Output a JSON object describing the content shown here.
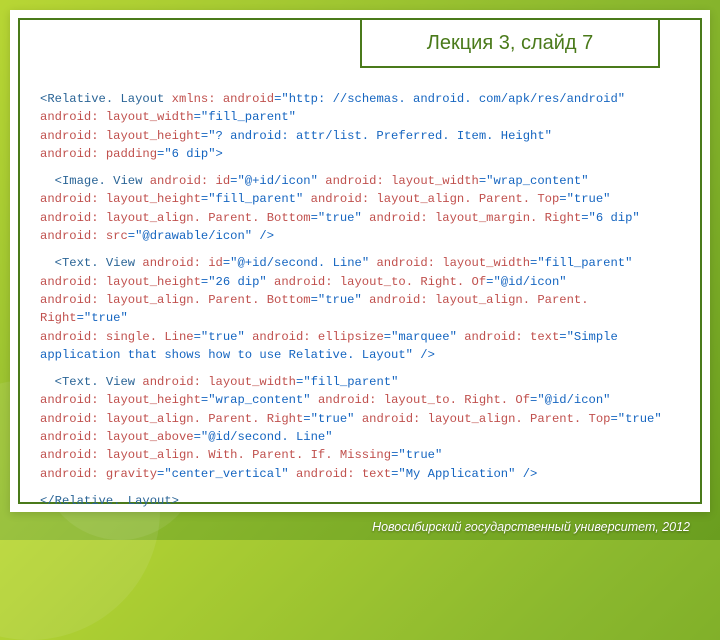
{
  "slide": {
    "title": "Лекция 3, слайд 7",
    "footer": "Новосибирский государственный университет, 2012"
  },
  "code": {
    "p1_a": "<Relative. Layout ",
    "p1_b": "xmlns: android",
    "p1_c": "=\"http: //schemas. android. com/apk/res/android\"",
    "p1_d": "android: layout_width",
    "p1_e": "=\"fill_parent\"",
    "p1_f": "android: layout_height",
    "p1_g": "=\"? android: attr/list. Preferred. Item. Height\"",
    "p1_h": "android: padding",
    "p1_i": "=\"6 dip\">",
    "p2_a": "  <Image. View ",
    "p2_b": "android: id",
    "p2_c": "=\"@+id/icon\" ",
    "p2_d": "android: layout_width",
    "p2_e": "=\"wrap_content\"",
    "p2_f": "android: layout_height",
    "p2_g": "=\"fill_parent\" ",
    "p2_h": "android: layout_align. Parent. Top",
    "p2_i": "=\"true\"",
    "p2_j": "android: layout_align. Parent. Bottom",
    "p2_k": "=\"true\" ",
    "p2_l": "android: layout_margin. Right",
    "p2_m": "=\"6 dip\"",
    "p2_n": "android: src",
    "p2_o": "=\"@drawable/icon\" />",
    "p3_a": "  <Text. View ",
    "p3_b": "android: id",
    "p3_c": "=\"@+id/second. Line\" ",
    "p3_d": "android: layout_width",
    "p3_e": "=\"fill_parent\"",
    "p3_f": "android: layout_height",
    "p3_g": "=\"26 dip\" ",
    "p3_h": "android: layout_to. Right. Of",
    "p3_i": "=\"@id/icon\"",
    "p3_j": "android: layout_align. Parent. Bottom",
    "p3_k": "=\"true\" ",
    "p3_l": "android: layout_align. Parent. Right",
    "p3_m": "=\"true\"",
    "p3_n": "android: single. Line",
    "p3_o": "=\"true\" ",
    "p3_p": "android: ellipsize",
    "p3_q": "=\"marquee\" ",
    "p3_r": "android: text",
    "p3_s": "=\"Simple application that shows how to use Relative. Layout\" />",
    "p4_a": "  <Text. View ",
    "p4_b": "android: layout_width",
    "p4_c": "=\"fill_parent\"",
    "p4_d": "android: layout_height",
    "p4_e": "=\"wrap_content\" ",
    "p4_f": "android: layout_to. Right. Of",
    "p4_g": "=\"@id/icon\"",
    "p4_h": "android: layout_align. Parent. Right",
    "p4_i": "=\"true\" ",
    "p4_j": "android: layout_align. Parent. Top",
    "p4_k": "=\"true\"",
    "p4_l": "android: layout_above",
    "p4_m": "=\"@id/second. Line\"",
    "p4_n": "android: layout_align. With. Parent. If. Missing",
    "p4_o": "=\"true\"",
    "p4_p": "android: gravity",
    "p4_q": "=\"center_vertical\" ",
    "p4_r": "android: text",
    "p4_s": "=\"My Application\" />",
    "p5": "</Relative. Layout>"
  }
}
